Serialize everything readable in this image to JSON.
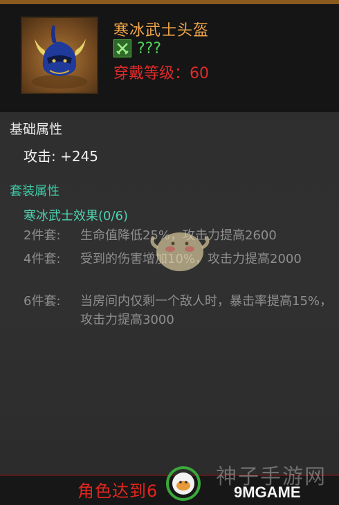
{
  "item": {
    "name": "寒冰武士头盔",
    "class_text": "???",
    "level_text": "穿戴等级：60",
    "icon": "helmet-icon",
    "class_icon": "crossed-swords-icon"
  },
  "base_section": {
    "title": "基础属性",
    "attack": "攻击: +245"
  },
  "set_section": {
    "title": "套装属性",
    "set_name": "寒冰武士效果(0/6)",
    "bonuses": [
      {
        "label": "2件套:",
        "text": "生命值降低25%，攻击力提高2600"
      },
      {
        "label": "4件套:",
        "text": "受到的伤害增加10%，攻击力提高2000"
      },
      {
        "label": "6件套:",
        "text": "当房间内仅剩一个敌人时，暴击率提高15%，攻击力提高3000"
      }
    ]
  },
  "footer": {
    "requirement_text": "角色达到6"
  },
  "watermark": {
    "cn_text": "神子手游网",
    "en_text": "9MGAME"
  },
  "colors": {
    "item_name": "#f0a44a",
    "class_text": "#4fd25a",
    "level_text": "#e02a2a",
    "set_title": "#3fc8a6",
    "set_bonus": "#8e8e8e",
    "footer_text": "#e0261f",
    "top_border": "#8a5a1e"
  }
}
